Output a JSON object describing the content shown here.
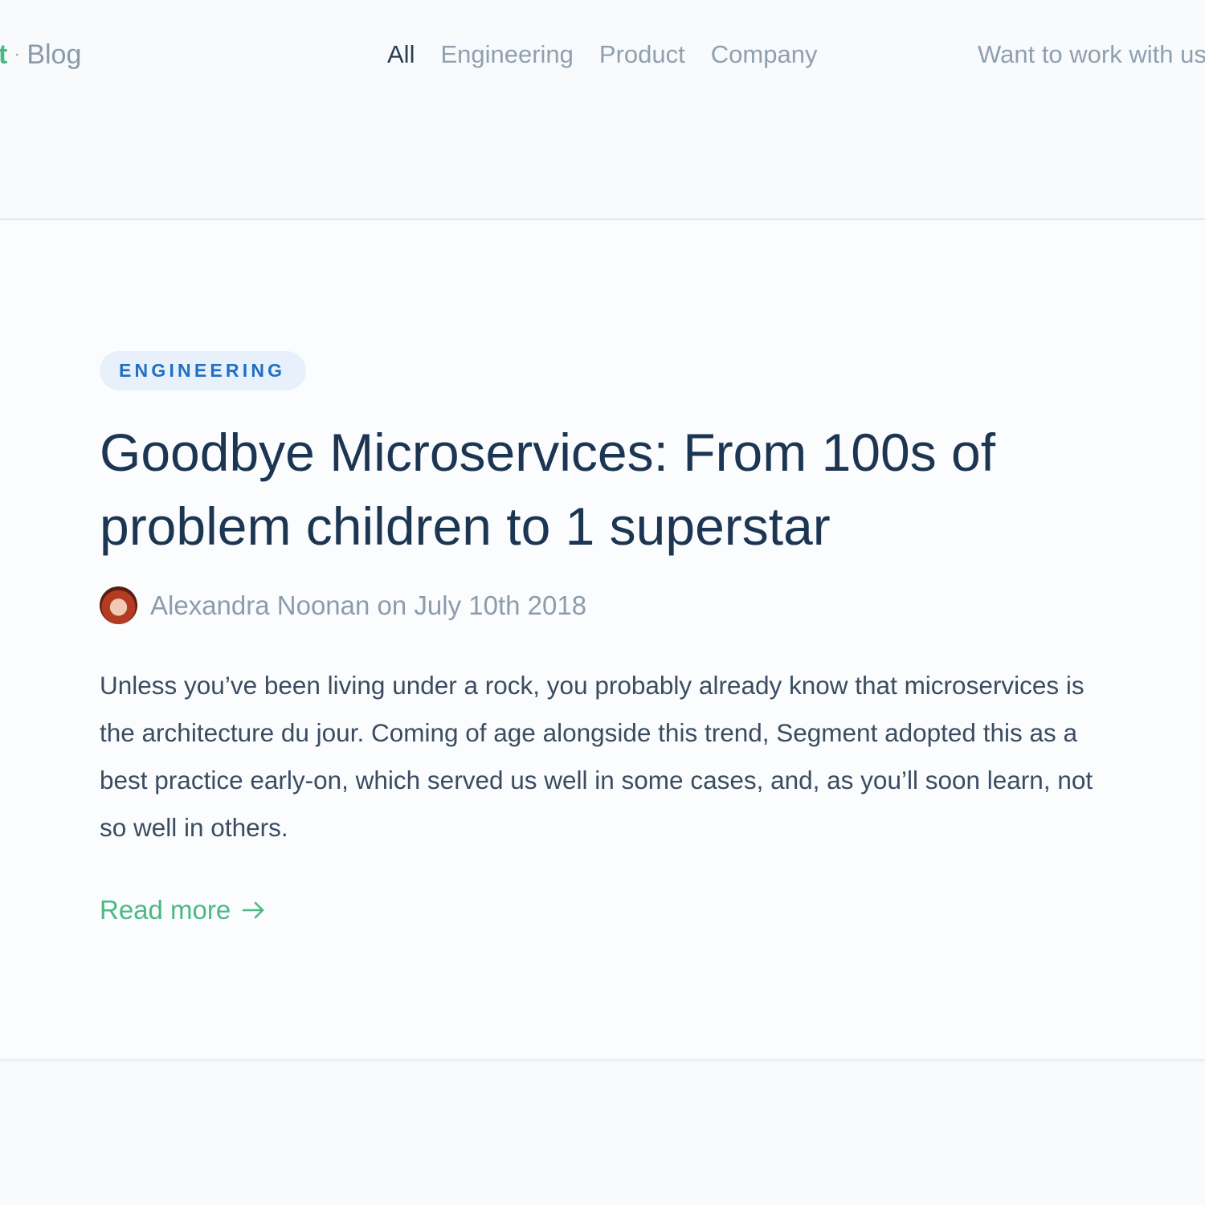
{
  "header": {
    "brand_mark": "t",
    "brand_separator": "·",
    "brand_blog": "Blog",
    "nav": [
      {
        "label": "All",
        "active": true
      },
      {
        "label": "Engineering",
        "active": false
      },
      {
        "label": "Product",
        "active": false
      },
      {
        "label": "Company",
        "active": false
      }
    ],
    "cta": "Want to work with us"
  },
  "article": {
    "tag": "ENGINEERING",
    "title": "Goodbye Microservices: From 100s of problem children to 1 superstar",
    "meta": "Alexandra Noonan on July 10th 2018",
    "excerpt": "Unless you’ve been living under a rock, you probably already know that microservices is the architecture du jour. Coming of age alongside this trend, Segment adopted this as a best practice early-on, which served us well in some cases, and, as you’ll soon learn, not so well in others.",
    "read_more": "Read more",
    "read_more_icon": "arrow-right-icon",
    "avatar_icon": "author-avatar"
  },
  "colors": {
    "accent_green": "#4cb985",
    "tag_text": "#1f6fc3",
    "tag_bg": "#e8f1fb",
    "title": "#1b3552"
  }
}
